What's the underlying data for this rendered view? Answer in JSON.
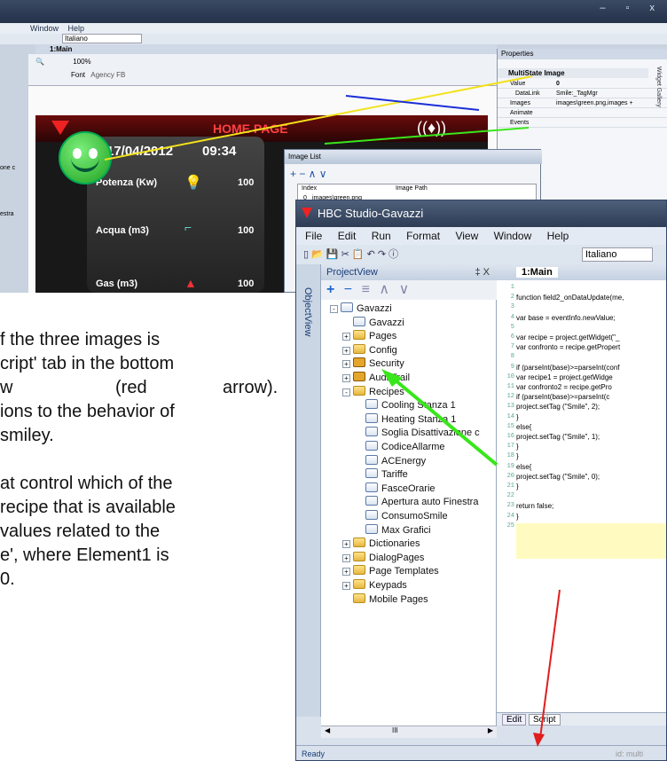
{
  "screenshot_top": {
    "menu": [
      "Window",
      "Help"
    ],
    "language_select": "Italiano",
    "tab_label": "1:Main",
    "zoom": "100%",
    "font_label": "Font",
    "font_value": "Agency FB",
    "home_page_title": "HOME PAGE",
    "date": "17/04/2012",
    "time": "09:34",
    "rows": [
      {
        "label": "Potenza (Kw)",
        "value": "100"
      },
      {
        "label": "Acqua (m3)",
        "value": "100"
      },
      {
        "label": "Gas (m3)",
        "value": "100"
      }
    ],
    "properties": {
      "title": "Properties",
      "object_title": "MultiState Image",
      "rows": [
        {
          "name": "Value",
          "value": "0"
        },
        {
          "name": "DataLink",
          "value": "Smile:_TagMgr"
        },
        {
          "name": "Images",
          "value": "images\\green.png,images +"
        },
        {
          "name": "Animate",
          "value": ""
        },
        {
          "name": "Events",
          "value": ""
        }
      ],
      "side_label": "Widget Gallery"
    },
    "image_list": {
      "title": "Image List",
      "col_index": "Index",
      "col_path": "Image Path",
      "row_index": "0",
      "row_path": "images\\green.png"
    },
    "left_fragments": [
      "one c",
      "estra"
    ]
  },
  "paragraph": {
    "line1": "f the three images is",
    "line2": "cript' tab in the bottom",
    "line3a": "w",
    "line3b": "(red",
    "line3c": "arrow).",
    "line4": "ions to the behavior of",
    "line5": "smiley.",
    "line6": "at control which of the",
    "line7": "recipe that is available",
    "line8": "values related to the",
    "line9": "e', where Element1 is",
    "line10": "0."
  },
  "studio": {
    "title": "HBC Studio-Gavazzi",
    "menu": [
      "File",
      "Edit",
      "Run",
      "Format",
      "View",
      "Window",
      "Help"
    ],
    "language": "Italiano",
    "object_view_label": "ObjectView",
    "project_view_label": "ProjectView",
    "pin_label": "‡ X",
    "editor_tab": "1:Main",
    "tree": [
      {
        "label": "Gavazzi",
        "indent": 0,
        "icon": "root",
        "exp": "-"
      },
      {
        "label": "Gavazzi",
        "indent": 1,
        "icon": "doc",
        "exp": ""
      },
      {
        "label": "Pages",
        "indent": 1,
        "icon": "folder",
        "exp": "+"
      },
      {
        "label": "Config",
        "indent": 1,
        "icon": "folder",
        "exp": "+"
      },
      {
        "label": "Security",
        "indent": 1,
        "icon": "lock",
        "exp": "+"
      },
      {
        "label": "AuditTrail",
        "indent": 1,
        "icon": "lock",
        "exp": "+"
      },
      {
        "label": "Recipes",
        "indent": 1,
        "icon": "folder",
        "exp": "-"
      },
      {
        "label": "Cooling Stanza 1",
        "indent": 2,
        "icon": "doc",
        "exp": ""
      },
      {
        "label": "Heating Stanza 1",
        "indent": 2,
        "icon": "doc",
        "exp": ""
      },
      {
        "label": "Soglia Disattivazione c",
        "indent": 2,
        "icon": "doc",
        "exp": ""
      },
      {
        "label": "CodiceAllarme",
        "indent": 2,
        "icon": "doc",
        "exp": ""
      },
      {
        "label": "ACEnergy",
        "indent": 2,
        "icon": "doc",
        "exp": ""
      },
      {
        "label": "Tariffe",
        "indent": 2,
        "icon": "doc",
        "exp": ""
      },
      {
        "label": "FasceOrarie",
        "indent": 2,
        "icon": "doc",
        "exp": ""
      },
      {
        "label": "Apertura auto Finestra",
        "indent": 2,
        "icon": "doc",
        "exp": ""
      },
      {
        "label": "ConsumoSmile",
        "indent": 2,
        "icon": "doc",
        "exp": ""
      },
      {
        "label": "Max Grafici",
        "indent": 2,
        "icon": "doc",
        "exp": ""
      },
      {
        "label": "Dictionaries",
        "indent": 1,
        "icon": "folder",
        "exp": "+"
      },
      {
        "label": "DialogPages",
        "indent": 1,
        "icon": "folder",
        "exp": "+"
      },
      {
        "label": "Page Templates",
        "indent": 1,
        "icon": "folder",
        "exp": "+"
      },
      {
        "label": "Keypads",
        "indent": 1,
        "icon": "folder",
        "exp": "+"
      },
      {
        "label": "Mobile Pages",
        "indent": 1,
        "icon": "folder",
        "exp": ""
      }
    ],
    "code": [
      {
        "n": "1",
        "t": ""
      },
      {
        "n": "2",
        "t": "function field2_onDataUpdate(me,"
      },
      {
        "n": "3",
        "t": ""
      },
      {
        "n": "4",
        "t": "var base = eventInfo.newValue;"
      },
      {
        "n": "5",
        "t": ""
      },
      {
        "n": "6",
        "t": "var recipe = project.getWidget(\"_"
      },
      {
        "n": "7",
        "t": "var confronto = recipe.getPropert"
      },
      {
        "n": "8",
        "t": ""
      },
      {
        "n": "9",
        "t": "if (parseInt(base)>=parseInt(conf"
      },
      {
        "n": "10",
        "t": "   var recipe1 = project.getWidge"
      },
      {
        "n": "11",
        "t": "   var confronto2 = recipe.getPro"
      },
      {
        "n": "12",
        "t": "   if (parseInt(base)>=parseInt(c"
      },
      {
        "n": "13",
        "t": "      project.setTag (\"Smile\", 2);"
      },
      {
        "n": "14",
        "t": "   }"
      },
      {
        "n": "15",
        "t": "   else{"
      },
      {
        "n": "16",
        "t": "      project.setTag (\"Smile\", 1);"
      },
      {
        "n": "17",
        "t": "   }"
      },
      {
        "n": "18",
        "t": "}"
      },
      {
        "n": "19",
        "t": "else{"
      },
      {
        "n": "20",
        "t": "   project.setTag (\"Smile\", 0);"
      },
      {
        "n": "21",
        "t": "}"
      },
      {
        "n": "22",
        "t": ""
      },
      {
        "n": "23",
        "t": "   return false;"
      },
      {
        "n": "24",
        "t": "}"
      },
      {
        "n": "25",
        "t": ""
      }
    ],
    "tab_edit": "Edit",
    "tab_script": "Script",
    "status": "Ready",
    "status_right": "id: multi",
    "scroll_label": "III"
  },
  "arrow_colors": {
    "yellow": "#f2e21a",
    "blue": "#1a2fd8",
    "green": "#39e61b",
    "red": "#e11d1d"
  }
}
